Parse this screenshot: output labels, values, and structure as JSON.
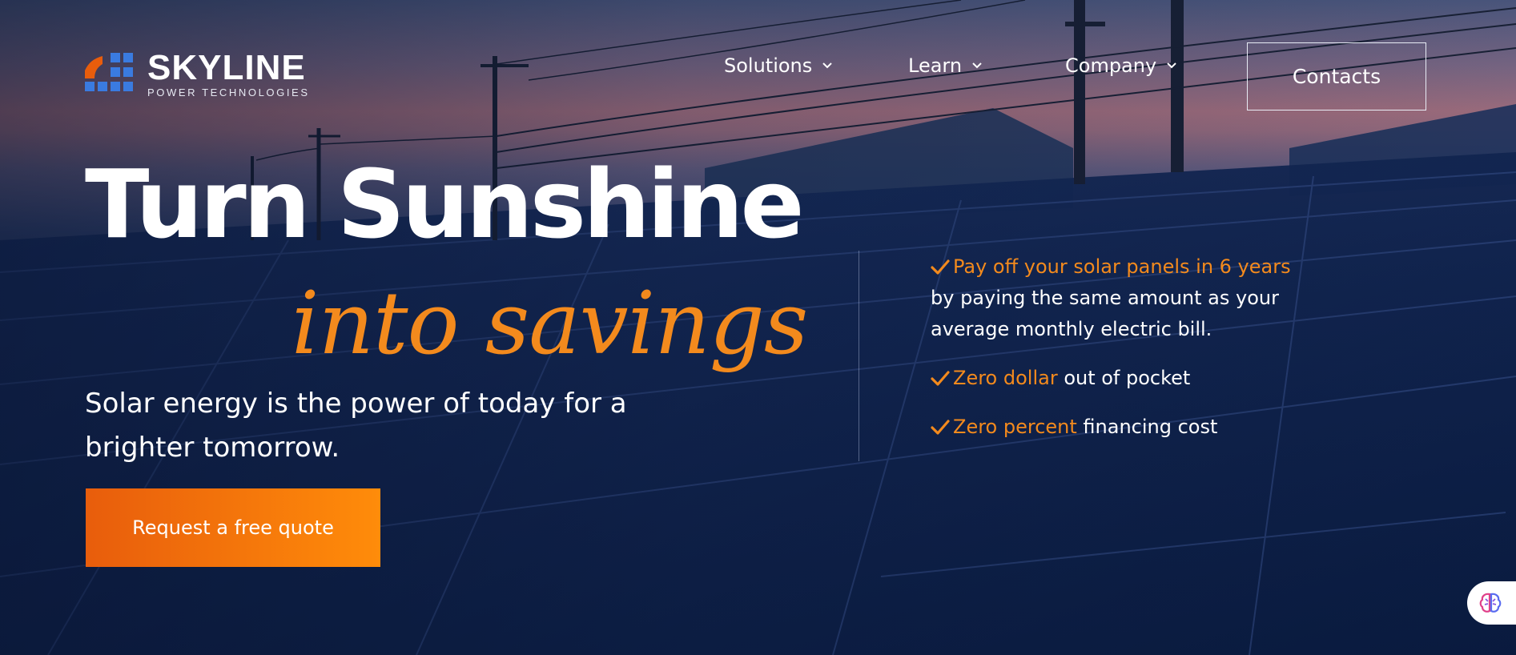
{
  "brand": {
    "name": "SKYLINE",
    "tagline": "POWER TECHNOLOGIES",
    "colors": {
      "orange": "#f38a1d",
      "blue": "#3a7be0",
      "cta_start": "#e85d0c",
      "cta_end": "#ff8c0a"
    }
  },
  "nav": {
    "items": [
      {
        "label": "Solutions",
        "icon": "chevron-down-icon"
      },
      {
        "label": "Learn",
        "icon": "chevron-down-icon"
      },
      {
        "label": "Company",
        "icon": "chevron-down-icon"
      }
    ],
    "contacts_label": "Contacts"
  },
  "hero": {
    "headline": "Turn Sunshine",
    "headline_accent": "into savings",
    "subheadline": "Solar energy is the power of today for a brighter tomorrow.",
    "cta_label": "Request a free quote"
  },
  "benefits": [
    {
      "highlight": "Pay off your solar panels in 6 years",
      "text": "by paying the same amount as your average monthly electric bill."
    },
    {
      "highlight": "Zero dollar",
      "text": " out of pocket"
    },
    {
      "highlight": "Zero percent",
      "text": " financing cost"
    }
  ],
  "assistant": {
    "icon": "brain-icon"
  }
}
